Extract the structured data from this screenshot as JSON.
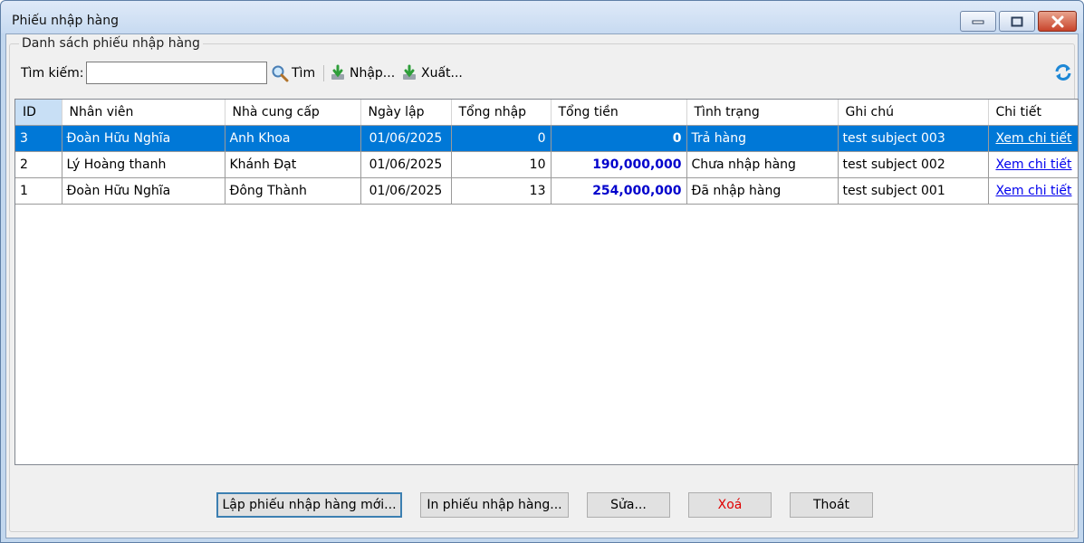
{
  "window": {
    "title": "Phiếu nhập hàng"
  },
  "group": {
    "title": "Danh sách phiếu nhập hàng"
  },
  "toolbar": {
    "search_label": "Tìm kiếm:",
    "search_value": "",
    "search_button": "Tìm",
    "import_button": "Nhập...",
    "export_button": "Xuất..."
  },
  "table": {
    "columns": [
      "ID",
      "Nhân viên",
      "Nhà cung cấp",
      "Ngày lập",
      "Tổng nhập",
      "Tổng tiền",
      "Tình trạng",
      "Ghi chú",
      "Chi tiết"
    ],
    "rows": [
      {
        "id": "3",
        "staff": "Đoàn Hữu Nghĩa",
        "supplier": "Anh Khoa",
        "date": "01/06/2025",
        "qty": "0",
        "total": "0",
        "status": "Trả hàng",
        "note": "test subject 003",
        "detail": "Xem chi tiết",
        "selected": true
      },
      {
        "id": "2",
        "staff": "Lý Hoàng thanh",
        "supplier": "Khánh Đạt",
        "date": "01/06/2025",
        "qty": "10",
        "total": "190,000,000",
        "status": "Chưa nhập hàng",
        "note": "test subject 002",
        "detail": "Xem chi tiết",
        "selected": false
      },
      {
        "id": "1",
        "staff": "Đoàn Hữu Nghĩa",
        "supplier": "Đông Thành",
        "date": "01/06/2025",
        "qty": "13",
        "total": "254,000,000",
        "status": "Đã nhập hàng",
        "note": "test subject 001",
        "detail": "Xem chi tiết",
        "selected": false
      }
    ]
  },
  "buttons": {
    "new": "Lập phiếu nhập hàng mới...",
    "print": "In phiếu nhập hàng...",
    "edit": "Sửa...",
    "delete": "Xoá",
    "exit": "Thoát"
  },
  "colors": {
    "selection": "#0078d7",
    "money": "#0000cc",
    "delete": "#e00000",
    "link": "#0000ee"
  },
  "icons": {
    "search": "magnifier-icon",
    "import": "download-arrow-icon",
    "export": "download-arrow-icon",
    "refresh": "refresh-icon"
  }
}
